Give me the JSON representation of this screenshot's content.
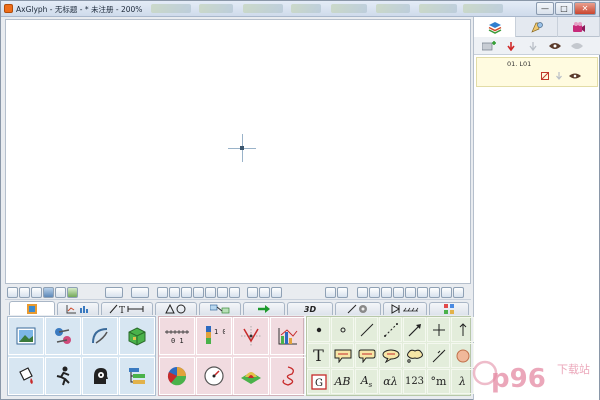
{
  "window": {
    "title": "AxGlyph - 无标题 - * 未注册 - 200%",
    "controls": {
      "minimize": "—",
      "maximize": "□",
      "close": "✕"
    }
  },
  "right_panel": {
    "tabs": [
      {
        "name": "layers-tab",
        "icon": "layers-icon"
      },
      {
        "name": "palette-tab",
        "icon": "palette-icon"
      },
      {
        "name": "scene-tab",
        "icon": "film-icon"
      }
    ],
    "layer": {
      "name": "01. L01"
    }
  },
  "category_tabs": [
    {
      "name": "tab-images",
      "label": ""
    },
    {
      "name": "tab-charts",
      "label": ""
    },
    {
      "name": "tab-lines",
      "label": ""
    },
    {
      "name": "tab-shapes",
      "label": ""
    },
    {
      "name": "tab-connectors",
      "label": ""
    },
    {
      "name": "tab-arrows",
      "label": ""
    },
    {
      "name": "tab-3d",
      "label": "3D"
    },
    {
      "name": "tab-mechanics",
      "label": ""
    },
    {
      "name": "tab-circuits",
      "label": ""
    },
    {
      "name": "tab-misc",
      "label": ""
    }
  ],
  "palette": {
    "chart_labels": {
      "axis": "0 1",
      "stack": "1 0"
    },
    "text_symbols": {
      "text_T": "T",
      "AB": "AB",
      "As": "A",
      "As_sub": "s",
      "alpha_lambda": "αλ",
      "num": "123",
      "degree_m": "°m",
      "lambda": "λ",
      "framed_G": "G"
    }
  },
  "watermark": {
    "text": "p96",
    "subtext": "下载站"
  },
  "colors": {
    "palette_blue": "#d7e6f2",
    "palette_pink": "#f1dbe0",
    "palette_green": "#e3eddb",
    "layer_highlight": "#fffbe0"
  }
}
